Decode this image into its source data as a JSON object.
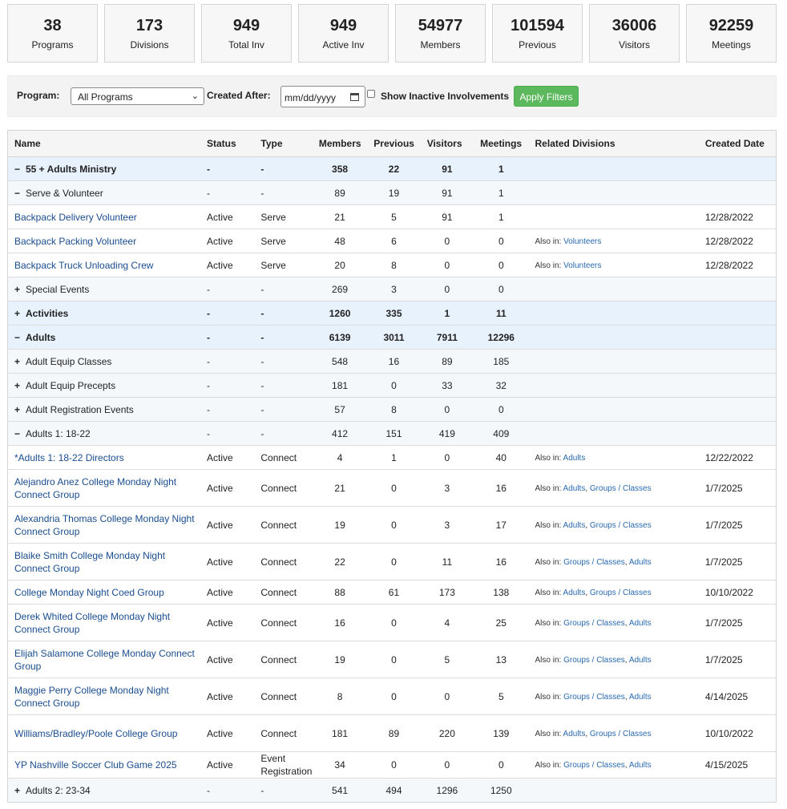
{
  "stats": [
    {
      "value": "38",
      "label": "Programs"
    },
    {
      "value": "173",
      "label": "Divisions"
    },
    {
      "value": "949",
      "label": "Total Inv"
    },
    {
      "value": "949",
      "label": "Active Inv"
    },
    {
      "value": "54977",
      "label": "Members"
    },
    {
      "value": "101594",
      "label": "Previous"
    },
    {
      "value": "36006",
      "label": "Visitors"
    },
    {
      "value": "92259",
      "label": "Meetings"
    }
  ],
  "filters": {
    "program_label": "Program:",
    "program_value": "All Programs",
    "created_after_label": "Created After:",
    "date_placeholder": "mm/dd/yyyy",
    "show_inactive_label": "Show Inactive Involvements",
    "apply_label": "Apply Filters"
  },
  "table": {
    "headers": [
      "Name",
      "Status",
      "Type",
      "Members",
      "Previous",
      "Visitors",
      "Meetings",
      "Related Divisions",
      "Created Date"
    ],
    "also_in": "Also in:",
    "rows": [
      {
        "level": 0,
        "toggle": "−",
        "name": "55 + Adults Ministry",
        "status": "-",
        "type": "-",
        "members": "358",
        "previous": "22",
        "visitors": "91",
        "meetings": "1",
        "related": [],
        "created": ""
      },
      {
        "level": 1,
        "toggle": "−",
        "name": "Serve & Volunteer",
        "status": "-",
        "type": "-",
        "members": "89",
        "previous": "19",
        "visitors": "91",
        "meetings": "1",
        "related": [],
        "created": ""
      },
      {
        "level": 2,
        "toggle": "",
        "name": "Backpack Delivery Volunteer",
        "status": "Active",
        "type": "Serve",
        "members": "21",
        "previous": "5",
        "visitors": "91",
        "meetings": "1",
        "related": [],
        "created": "12/28/2022"
      },
      {
        "level": 2,
        "toggle": "",
        "name": "Backpack Packing Volunteer",
        "status": "Active",
        "type": "Serve",
        "members": "48",
        "previous": "6",
        "visitors": "0",
        "meetings": "0",
        "related": [
          "Volunteers"
        ],
        "created": "12/28/2022"
      },
      {
        "level": 2,
        "toggle": "",
        "name": "Backpack Truck Unloading Crew",
        "status": "Active",
        "type": "Serve",
        "members": "20",
        "previous": "8",
        "visitors": "0",
        "meetings": "0",
        "related": [
          "Volunteers"
        ],
        "created": "12/28/2022"
      },
      {
        "level": 1,
        "toggle": "+",
        "name": "Special Events",
        "status": "-",
        "type": "-",
        "members": "269",
        "previous": "3",
        "visitors": "0",
        "meetings": "0",
        "related": [],
        "created": ""
      },
      {
        "level": 0,
        "toggle": "+",
        "name": "Activities",
        "status": "-",
        "type": "-",
        "members": "1260",
        "previous": "335",
        "visitors": "1",
        "meetings": "11",
        "related": [],
        "created": ""
      },
      {
        "level": 0,
        "toggle": "−",
        "name": "Adults",
        "status": "-",
        "type": "-",
        "members": "6139",
        "previous": "3011",
        "visitors": "7911",
        "meetings": "12296",
        "related": [],
        "created": ""
      },
      {
        "level": 1,
        "toggle": "+",
        "name": "Adult Equip Classes",
        "status": "-",
        "type": "-",
        "members": "548",
        "previous": "16",
        "visitors": "89",
        "meetings": "185",
        "related": [],
        "created": ""
      },
      {
        "level": 1,
        "toggle": "+",
        "name": "Adult Equip Precepts",
        "status": "-",
        "type": "-",
        "members": "181",
        "previous": "0",
        "visitors": "33",
        "meetings": "32",
        "related": [],
        "created": ""
      },
      {
        "level": 1,
        "toggle": "+",
        "name": "Adult Registration Events",
        "status": "-",
        "type": "-",
        "members": "57",
        "previous": "8",
        "visitors": "0",
        "meetings": "0",
        "related": [],
        "created": ""
      },
      {
        "level": 1,
        "toggle": "−",
        "name": "Adults 1: 18-22",
        "status": "-",
        "type": "-",
        "members": "412",
        "previous": "151",
        "visitors": "419",
        "meetings": "409",
        "related": [],
        "created": ""
      },
      {
        "level": 2,
        "toggle": "",
        "name": "*Adults 1: 18-22 Directors",
        "status": "Active",
        "type": "Connect",
        "members": "4",
        "previous": "1",
        "visitors": "0",
        "meetings": "40",
        "related": [
          "Adults"
        ],
        "created": "12/22/2022"
      },
      {
        "level": 2,
        "toggle": "",
        "name": "Alejandro Anez College Monday Night Connect Group",
        "status": "Active",
        "type": "Connect",
        "members": "21",
        "previous": "0",
        "visitors": "3",
        "meetings": "16",
        "related": [
          "Adults",
          "Groups / Classes"
        ],
        "created": "1/7/2025"
      },
      {
        "level": 2,
        "toggle": "",
        "name": "Alexandria Thomas College Monday Night Connect Group",
        "status": "Active",
        "type": "Connect",
        "members": "19",
        "previous": "0",
        "visitors": "3",
        "meetings": "17",
        "related": [
          "Adults",
          "Groups / Classes"
        ],
        "created": "1/7/2025"
      },
      {
        "level": 2,
        "toggle": "",
        "name": "Blaike Smith College Monday Night Connect Group",
        "status": "Active",
        "type": "Connect",
        "members": "22",
        "previous": "0",
        "visitors": "11",
        "meetings": "16",
        "related": [
          "Groups / Classes",
          "Adults"
        ],
        "created": "1/7/2025"
      },
      {
        "level": 2,
        "toggle": "",
        "name": "College Monday Night Coed Group",
        "status": "Active",
        "type": "Connect",
        "members": "88",
        "previous": "61",
        "visitors": "173",
        "meetings": "138",
        "related": [
          "Adults",
          "Groups / Classes"
        ],
        "created": "10/10/2022"
      },
      {
        "level": 2,
        "toggle": "",
        "name": "Derek Whited College Monday Night Connect Group",
        "status": "Active",
        "type": "Connect",
        "members": "16",
        "previous": "0",
        "visitors": "4",
        "meetings": "25",
        "related": [
          "Groups / Classes",
          "Adults"
        ],
        "created": "1/7/2025"
      },
      {
        "level": 2,
        "toggle": "",
        "name": "Elijah Salamone College Monday Connect Group",
        "status": "Active",
        "type": "Connect",
        "members": "19",
        "previous": "0",
        "visitors": "5",
        "meetings": "13",
        "related": [
          "Groups / Classes",
          "Adults"
        ],
        "created": "1/7/2025"
      },
      {
        "level": 2,
        "toggle": "",
        "name": "Maggie Perry College Monday Night Connect Group",
        "status": "Active",
        "type": "Connect",
        "members": "8",
        "previous": "0",
        "visitors": "0",
        "meetings": "5",
        "related": [
          "Groups / Classes",
          "Adults"
        ],
        "created": "4/14/2025"
      },
      {
        "level": 2,
        "toggle": "",
        "name": "Williams/Bradley/Poole College Group",
        "status": "Active",
        "type": "Connect",
        "members": "181",
        "previous": "89",
        "visitors": "220",
        "meetings": "139",
        "related": [
          "Adults",
          "Groups / Classes"
        ],
        "created": "10/10/2022"
      },
      {
        "level": 2,
        "toggle": "",
        "name": "YP Nashville Soccer Club Game 2025",
        "status": "Active",
        "type": "Event Registration",
        "members": "34",
        "previous": "0",
        "visitors": "0",
        "meetings": "0",
        "related": [
          "Groups / Classes",
          "Adults"
        ],
        "created": "4/15/2025"
      },
      {
        "level": 1,
        "toggle": "+",
        "name": "Adults 2: 23-34",
        "status": "-",
        "type": "-",
        "members": "541",
        "previous": "494",
        "visitors": "1296",
        "meetings": "1250",
        "related": [],
        "created": ""
      }
    ]
  }
}
